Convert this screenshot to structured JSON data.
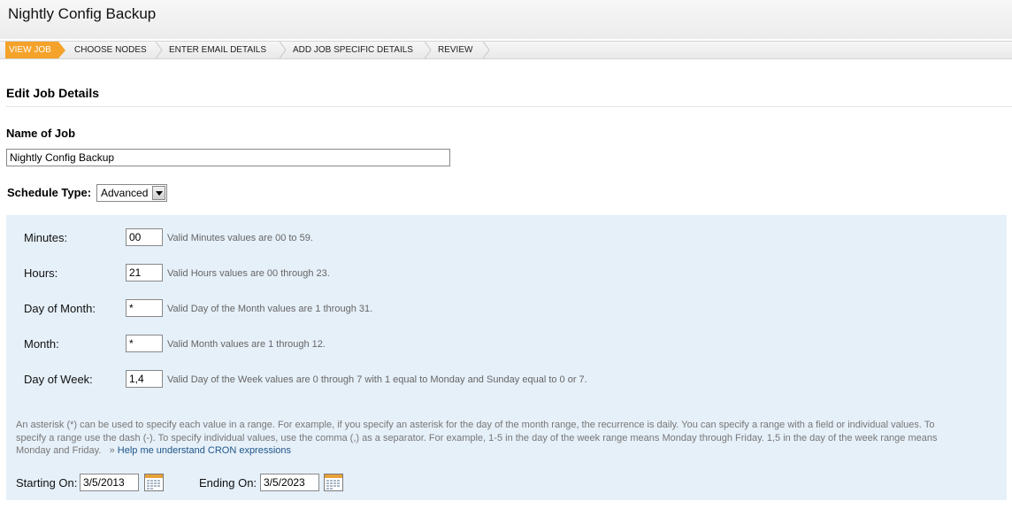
{
  "page": {
    "title": "Nightly Config Backup"
  },
  "steps": [
    {
      "label": "VIEW JOB",
      "active": true
    },
    {
      "label": "CHOOSE NODES",
      "active": false
    },
    {
      "label": "ENTER EMAIL DETAILS",
      "active": false
    },
    {
      "label": "ADD JOB SPECIFIC DETAILS",
      "active": false
    },
    {
      "label": "REVIEW",
      "active": false
    }
  ],
  "section": {
    "heading": "Edit Job Details"
  },
  "job_name": {
    "label": "Name of Job",
    "value": "Nightly Config Backup"
  },
  "schedule": {
    "label": "Schedule Type:",
    "selected": "Advanced"
  },
  "cron": {
    "minutes": {
      "label": "Minutes:",
      "value": "00",
      "hint": "Valid Minutes values are 00 to 59."
    },
    "hours": {
      "label": "Hours:",
      "value": "21",
      "hint": "Valid Hours values are 00 through 23."
    },
    "day_of_month": {
      "label": "Day of Month:",
      "value": "*",
      "hint": "Valid Day of the Month values are 1 through 31."
    },
    "month": {
      "label": "Month:",
      "value": "*",
      "hint": "Valid Month values are 1 through 12."
    },
    "day_of_week": {
      "label": "Day of Week:",
      "value": "1,4",
      "hint": "Valid Day of the Week values are 0 through 7 with 1 equal to Monday and Sunday equal to 0 or 7."
    }
  },
  "help": {
    "text": "An asterisk (*) can be used to specify each value in a range. For example, if you specify an asterisk for the day of the month range, the recurrence is daily. You can specify a range with a field or individual values. To specify a range use the dash (-). To specify individual values, use the comma (,) as a separator. For example, 1-5 in the day of the week range means Monday through Friday. 1,5 in the day of the week range means Monday and Friday.",
    "link_prefix": "»",
    "link_text": "Help me understand CRON expressions"
  },
  "dates": {
    "start": {
      "label": "Starting On:",
      "value": "3/5/2013"
    },
    "end": {
      "label": "Ending On:",
      "value": "3/5/2023"
    }
  },
  "colors": {
    "accent": "#f4a22a",
    "panel": "#e6f0f9",
    "link": "#20568a"
  }
}
